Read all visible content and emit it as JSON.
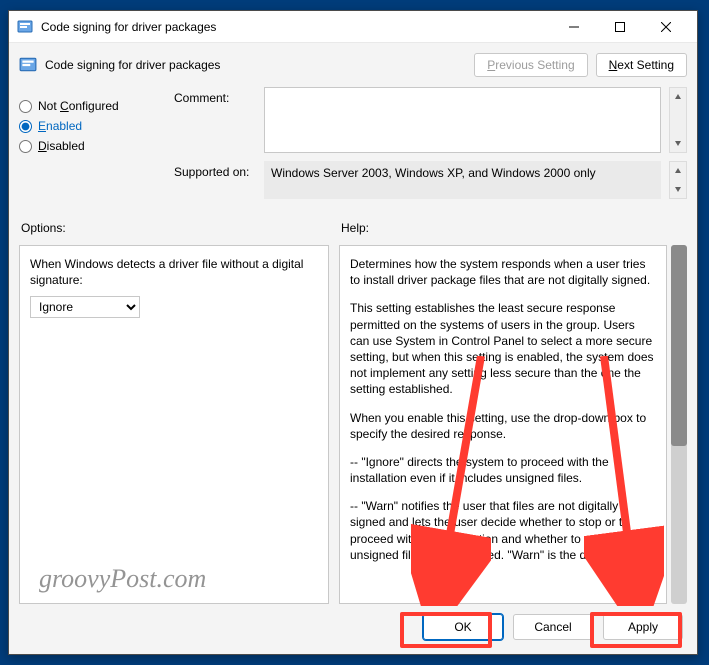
{
  "window": {
    "title": "Code signing for driver packages"
  },
  "header": {
    "title": "Code signing for driver packages",
    "prev_label": "Previous Setting",
    "prev_ul": "P",
    "next_label": "Next Setting",
    "next_ul": "N"
  },
  "radios": {
    "not_configured": "Not Configured",
    "not_configured_ul": "C",
    "enabled": "Enabled",
    "enabled_ul": "E",
    "disabled": "Disabled",
    "disabled_ul": "D",
    "selected": "enabled"
  },
  "fields": {
    "comment_label": "Comment:",
    "comment_value": "",
    "supported_label": "Supported on:",
    "supported_value": "Windows Server 2003, Windows XP, and Windows 2000 only"
  },
  "options": {
    "label": "Options:",
    "prompt": "When Windows detects a driver file without a digital signature:",
    "select_value": "Ignore"
  },
  "help": {
    "label": "Help:",
    "p1": "Determines how the system responds when a user tries to install driver package files that are not digitally signed.",
    "p2": "This setting establishes the least secure response permitted on the systems of users in the group. Users can use System in Control Panel to select a more secure setting, but when this setting is enabled, the system does not implement any setting less secure than the one the setting established.",
    "p3": "When you enable this setting, use the drop-down box to specify the desired response.",
    "p4": "--   \"Ignore\" directs the system to proceed with the installation even if it includes unsigned files.",
    "p5": "--   \"Warn\" notifies the user that files are not digitally signed and lets the user decide whether to stop or to proceed with the installation and whether to permit unsigned files to be installed. \"Warn\" is the default."
  },
  "footer": {
    "ok": "OK",
    "cancel": "Cancel",
    "apply": "Apply"
  },
  "watermark": "groovyPost.com"
}
